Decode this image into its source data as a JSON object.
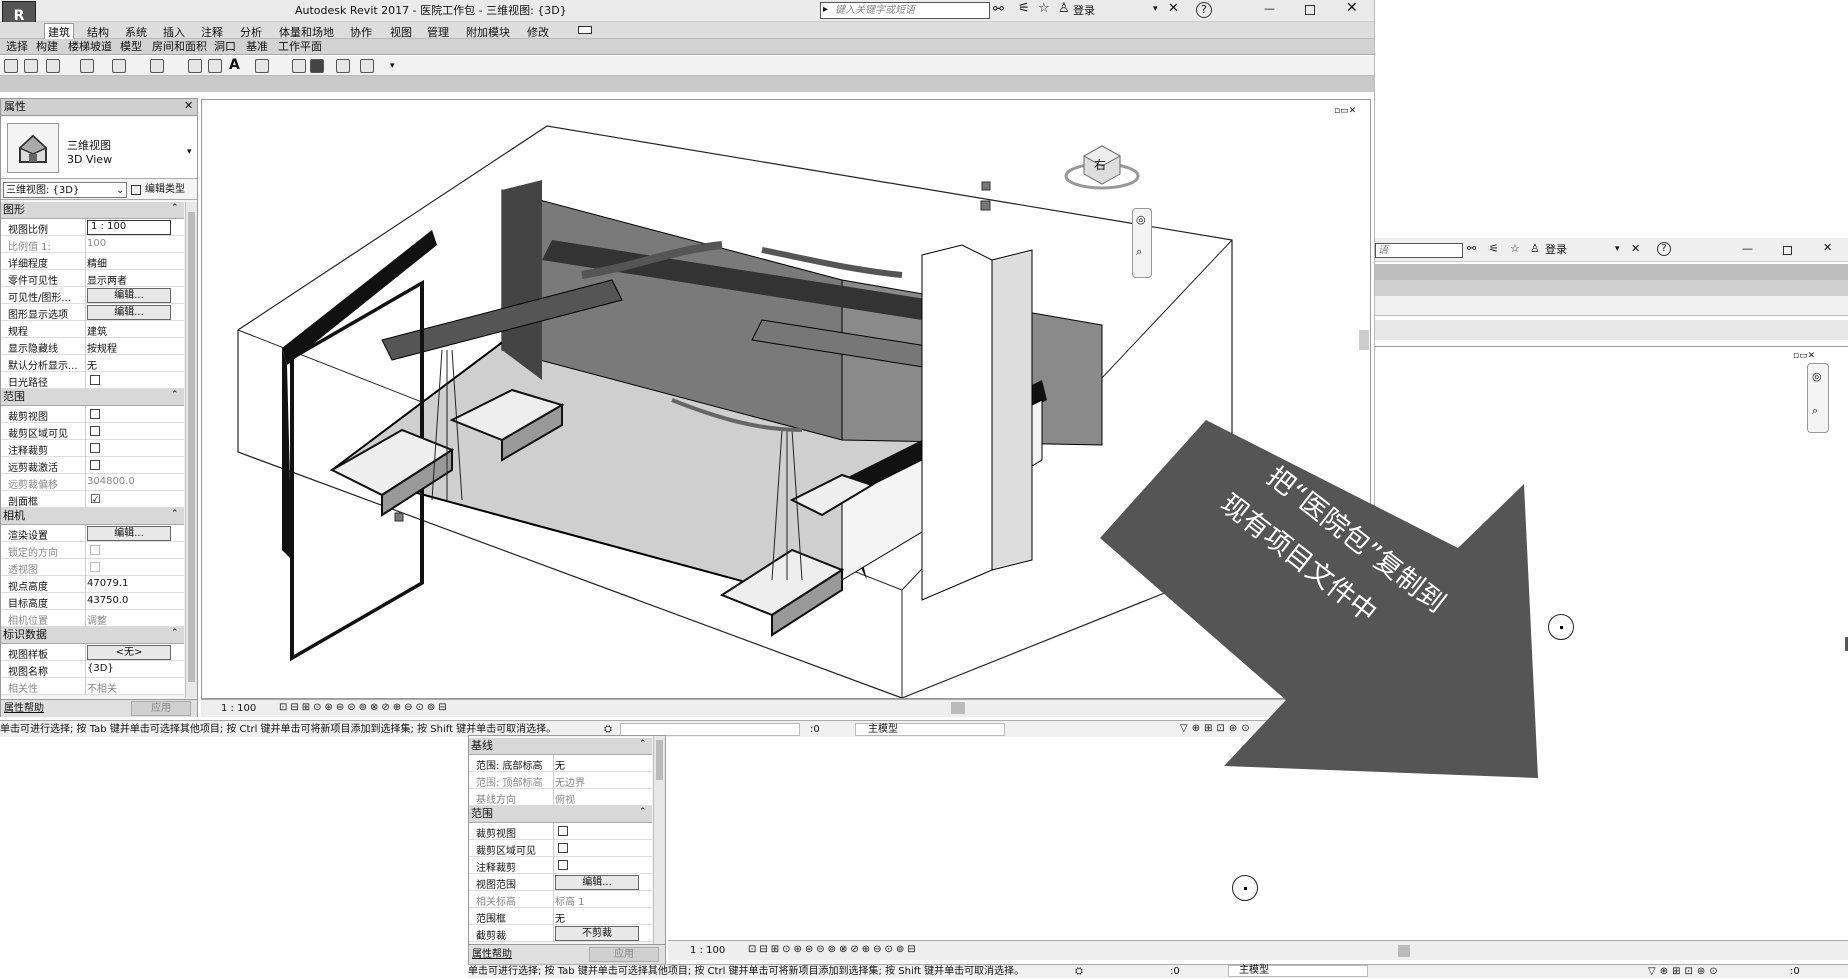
{
  "title": "Autodesk Revit 2017 -    医院工作包 - 三维视图: {3D}",
  "logo_text": "R",
  "search": {
    "placeholder": "键入关键字或短语",
    "login": "登录"
  },
  "search2": {
    "placeholder": "语",
    "login": "登录"
  },
  "menu": [
    "建筑",
    "结构",
    "系统",
    "插入",
    "注释",
    "分析",
    "体量和场地",
    "协作",
    "视图",
    "管理",
    "附加模块",
    "修改"
  ],
  "active_menu": "建筑",
  "sub_tabs": [
    "选择",
    "构建",
    "楼梯坡道",
    "模型",
    "房间和面积",
    "洞口",
    "基准",
    "工作平面"
  ],
  "properties": {
    "title": "属性",
    "type_line1": "三维视图",
    "type_line2": "3D View",
    "selector": "三维视图: {3D}",
    "edit_type": "编辑类型",
    "help": "属性帮助",
    "apply": "应用",
    "groups": [
      {
        "header": "图形",
        "rows": [
          {
            "k": "视图比例",
            "v": "1 : 100",
            "kind": "input"
          },
          {
            "k": "比例值 1:",
            "v": "100",
            "kind": "grey"
          },
          {
            "k": "详细程度",
            "v": "精细",
            "kind": "text"
          },
          {
            "k": "零件可见性",
            "v": "显示两者",
            "kind": "text"
          },
          {
            "k": "可见性/图形...",
            "v": "编辑...",
            "kind": "button"
          },
          {
            "k": "图形显示选项",
            "v": "编辑...",
            "kind": "button"
          },
          {
            "k": "规程",
            "v": "建筑",
            "kind": "text"
          },
          {
            "k": "显示隐藏线",
            "v": "按规程",
            "kind": "text"
          },
          {
            "k": "默认分析显示...",
            "v": "无",
            "kind": "text"
          },
          {
            "k": "日光路径",
            "v": "",
            "kind": "check"
          }
        ]
      },
      {
        "header": "范围",
        "rows": [
          {
            "k": "裁剪视图",
            "v": "",
            "kind": "check"
          },
          {
            "k": "裁剪区域可见",
            "v": "",
            "kind": "check"
          },
          {
            "k": "注释裁剪",
            "v": "",
            "kind": "check"
          },
          {
            "k": "远剪裁激活",
            "v": "",
            "kind": "check"
          },
          {
            "k": "远剪裁偏移",
            "v": "304800.0",
            "kind": "grey"
          },
          {
            "k": "剖面框",
            "v": "☑",
            "kind": "checked"
          }
        ]
      },
      {
        "header": "相机",
        "rows": [
          {
            "k": "渲染设置",
            "v": "编辑...",
            "kind": "button"
          },
          {
            "k": "锁定的方向",
            "v": "",
            "kind": "greycheck"
          },
          {
            "k": "透视图",
            "v": "",
            "kind": "greycheck"
          },
          {
            "k": "视点高度",
            "v": "47079.1",
            "kind": "text"
          },
          {
            "k": "目标高度",
            "v": "43750.0",
            "kind": "text"
          },
          {
            "k": "相机位置",
            "v": "调整",
            "kind": "grey"
          }
        ]
      },
      {
        "header": "标识数据",
        "rows": [
          {
            "k": "视图样板",
            "v": "<无>",
            "kind": "button"
          },
          {
            "k": "视图名称",
            "v": "{3D}",
            "kind": "text"
          },
          {
            "k": "相关性",
            "v": "不相关",
            "kind": "grey"
          }
        ]
      }
    ]
  },
  "lower_properties": {
    "help": "属性帮助",
    "apply": "应用",
    "groups": [
      {
        "header": "基线",
        "rows": [
          {
            "k": "范围: 底部标高",
            "v": "无",
            "kind": "text"
          },
          {
            "k": "范围: 顶部标高",
            "v": "无边界",
            "kind": "grey"
          },
          {
            "k": "基线方向",
            "v": "俯视",
            "kind": "grey"
          }
        ]
      },
      {
        "header": "范围",
        "rows": [
          {
            "k": "裁剪视图",
            "v": "",
            "kind": "check"
          },
          {
            "k": "裁剪区域可见",
            "v": "",
            "kind": "check"
          },
          {
            "k": "注释裁剪",
            "v": "",
            "kind": "check"
          },
          {
            "k": "视图范围",
            "v": "编辑...",
            "kind": "button"
          },
          {
            "k": "相关标高",
            "v": "标高 1",
            "kind": "grey"
          },
          {
            "k": "范围框",
            "v": "无",
            "kind": "text"
          },
          {
            "k": "截剪裁",
            "v": "不剪裁",
            "kind": "button"
          }
        ]
      }
    ]
  },
  "view_scale": "1 : 100",
  "view_scale2": "1 : 100",
  "status_text": "单击可进行选择; 按 Tab 键并单击可选择其他项目; 按 Ctrl 键并单击可将新项目添加到选择集; 按 Shift 键并单击可取消选择。",
  "status_extra": ":0",
  "status_model": "主模型",
  "filter_count": ":0",
  "nav_cube_face": "右",
  "arrow_text": {
    "line1": "把“医院包”复制到",
    "line2": "现有项目文件中"
  },
  "accent": "#555555"
}
